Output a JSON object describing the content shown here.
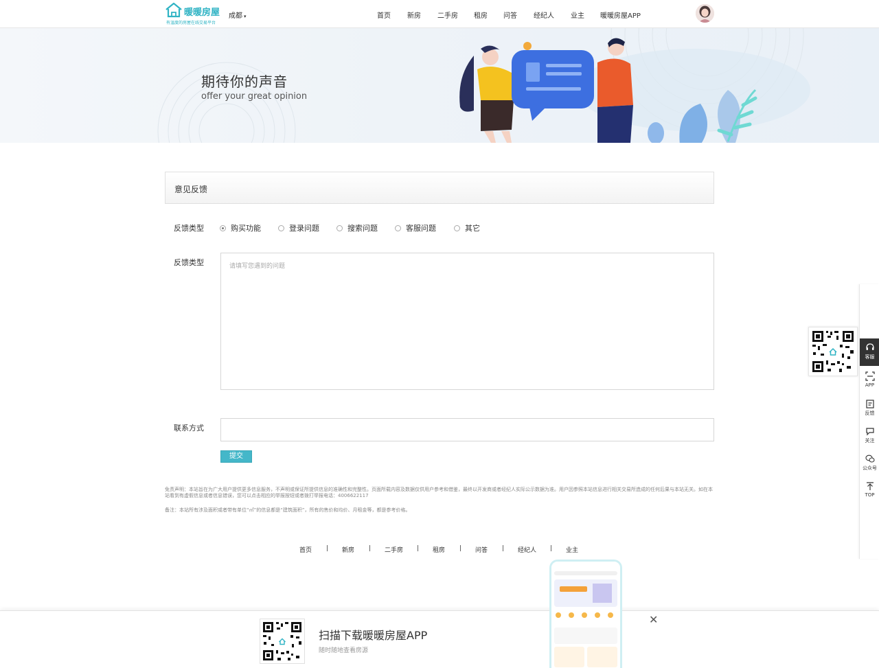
{
  "header": {
    "logo_text": "暖暖房屋",
    "logo_tagline": "有温度的房屋在线交易平台",
    "city": "成都",
    "nav": [
      "首页",
      "新房",
      "二手房",
      "租房",
      "问答",
      "经纪人",
      "业主",
      "暖暖房屋APP"
    ]
  },
  "banner": {
    "title": "期待你的声音",
    "subtitle": "offer your great opinion"
  },
  "feedback": {
    "panel_title": "意见反馈",
    "type_label": "反馈类型",
    "options": [
      "购买功能",
      "登录问题",
      "搜索问题",
      "客服问题",
      "其它"
    ],
    "selected": "购买功能",
    "content_label": "反馈类型",
    "content_placeholder": "请填写您遇到的问题",
    "contact_label": "联系方式",
    "contact_value": "",
    "submit_label": "提交"
  },
  "disclaimer": "免责声明：本站旨在为广大用户提供更多信息服务，不声明或保证所提供信息的准确性和完整性。页面所载内容及数据仅供用户参考和借鉴，最终以开发商或者经纪人实际公示数据为准。用户因参照本站信息进行相关交易所造成的任何后果与本站无关。如在本站看到有虚假信息或者信息错误，您可以点击相应的举报按钮或者拨打举报电话：4006622117",
  "note": "备注：本站所有涉及面积或者带有单位“㎡”的信息都是“建筑面积”，所有的售价和均价、月租金等，都是参考价格。",
  "footer_links": [
    "首页",
    "新房",
    "二手房",
    "租房",
    "问答",
    "经纪人",
    "业主"
  ],
  "footer_separator": "|",
  "sidebar": {
    "items": [
      "客服",
      "APP",
      "反馈",
      "关注",
      "公众号",
      "TOP"
    ]
  },
  "download_bar": {
    "title": "扫描下载暖暖房屋APP",
    "subtitle": "随时随地查看房源",
    "close": "✕"
  },
  "colors": {
    "brand": "#2fb3c4",
    "submit": "#44b7c9"
  }
}
